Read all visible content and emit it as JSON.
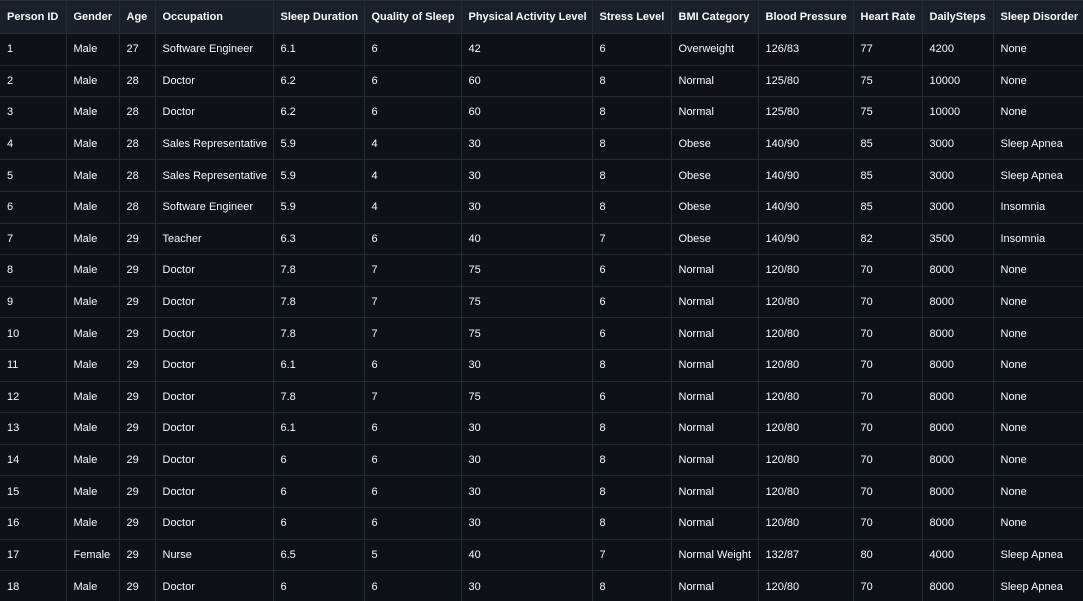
{
  "table": {
    "columns": [
      "Person ID",
      "Gender",
      "Age",
      "Occupation",
      "Sleep Duration",
      "Quality of Sleep",
      "Physical Activity Level",
      "Stress Level",
      "BMI Category",
      "Blood Pressure",
      "Heart Rate",
      "DailySteps",
      "Sleep Disorder"
    ],
    "rows": [
      [
        "1",
        "Male",
        "27",
        "Software Engineer",
        "6.1",
        "6",
        "42",
        "6",
        "Overweight",
        "126/83",
        "77",
        "4200",
        "None"
      ],
      [
        "2",
        "Male",
        "28",
        "Doctor",
        "6.2",
        "6",
        "60",
        "8",
        "Normal",
        "125/80",
        "75",
        "10000",
        "None"
      ],
      [
        "3",
        "Male",
        "28",
        "Doctor",
        "6.2",
        "6",
        "60",
        "8",
        "Normal",
        "125/80",
        "75",
        "10000",
        "None"
      ],
      [
        "4",
        "Male",
        "28",
        "Sales Representative",
        "5.9",
        "4",
        "30",
        "8",
        "Obese",
        "140/90",
        "85",
        "3000",
        "Sleep Apnea"
      ],
      [
        "5",
        "Male",
        "28",
        "Sales Representative",
        "5.9",
        "4",
        "30",
        "8",
        "Obese",
        "140/90",
        "85",
        "3000",
        "Sleep Apnea"
      ],
      [
        "6",
        "Male",
        "28",
        "Software Engineer",
        "5.9",
        "4",
        "30",
        "8",
        "Obese",
        "140/90",
        "85",
        "3000",
        "Insomnia"
      ],
      [
        "7",
        "Male",
        "29",
        "Teacher",
        "6.3",
        "6",
        "40",
        "7",
        "Obese",
        "140/90",
        "82",
        "3500",
        "Insomnia"
      ],
      [
        "8",
        "Male",
        "29",
        "Doctor",
        "7.8",
        "7",
        "75",
        "6",
        "Normal",
        "120/80",
        "70",
        "8000",
        "None"
      ],
      [
        "9",
        "Male",
        "29",
        "Doctor",
        "7.8",
        "7",
        "75",
        "6",
        "Normal",
        "120/80",
        "70",
        "8000",
        "None"
      ],
      [
        "10",
        "Male",
        "29",
        "Doctor",
        "7.8",
        "7",
        "75",
        "6",
        "Normal",
        "120/80",
        "70",
        "8000",
        "None"
      ],
      [
        "11",
        "Male",
        "29",
        "Doctor",
        "6.1",
        "6",
        "30",
        "8",
        "Normal",
        "120/80",
        "70",
        "8000",
        "None"
      ],
      [
        "12",
        "Male",
        "29",
        "Doctor",
        "7.8",
        "7",
        "75",
        "6",
        "Normal",
        "120/80",
        "70",
        "8000",
        "None"
      ],
      [
        "13",
        "Male",
        "29",
        "Doctor",
        "6.1",
        "6",
        "30",
        "8",
        "Normal",
        "120/80",
        "70",
        "8000",
        "None"
      ],
      [
        "14",
        "Male",
        "29",
        "Doctor",
        "6",
        "6",
        "30",
        "8",
        "Normal",
        "120/80",
        "70",
        "8000",
        "None"
      ],
      [
        "15",
        "Male",
        "29",
        "Doctor",
        "6",
        "6",
        "30",
        "8",
        "Normal",
        "120/80",
        "70",
        "8000",
        "None"
      ],
      [
        "16",
        "Male",
        "29",
        "Doctor",
        "6",
        "6",
        "30",
        "8",
        "Normal",
        "120/80",
        "70",
        "8000",
        "None"
      ],
      [
        "17",
        "Female",
        "29",
        "Nurse",
        "6.5",
        "5",
        "40",
        "7",
        "Normal Weight",
        "132/87",
        "80",
        "4000",
        "Sleep Apnea"
      ],
      [
        "18",
        "Male",
        "29",
        "Doctor",
        "6",
        "6",
        "30",
        "8",
        "Normal",
        "120/80",
        "70",
        "8000",
        "Sleep Apnea"
      ]
    ]
  },
  "colors": {
    "background": "#0e1117",
    "header_background": "#1a1f29",
    "grid_line": "#262b36",
    "text": "#fafafa"
  }
}
